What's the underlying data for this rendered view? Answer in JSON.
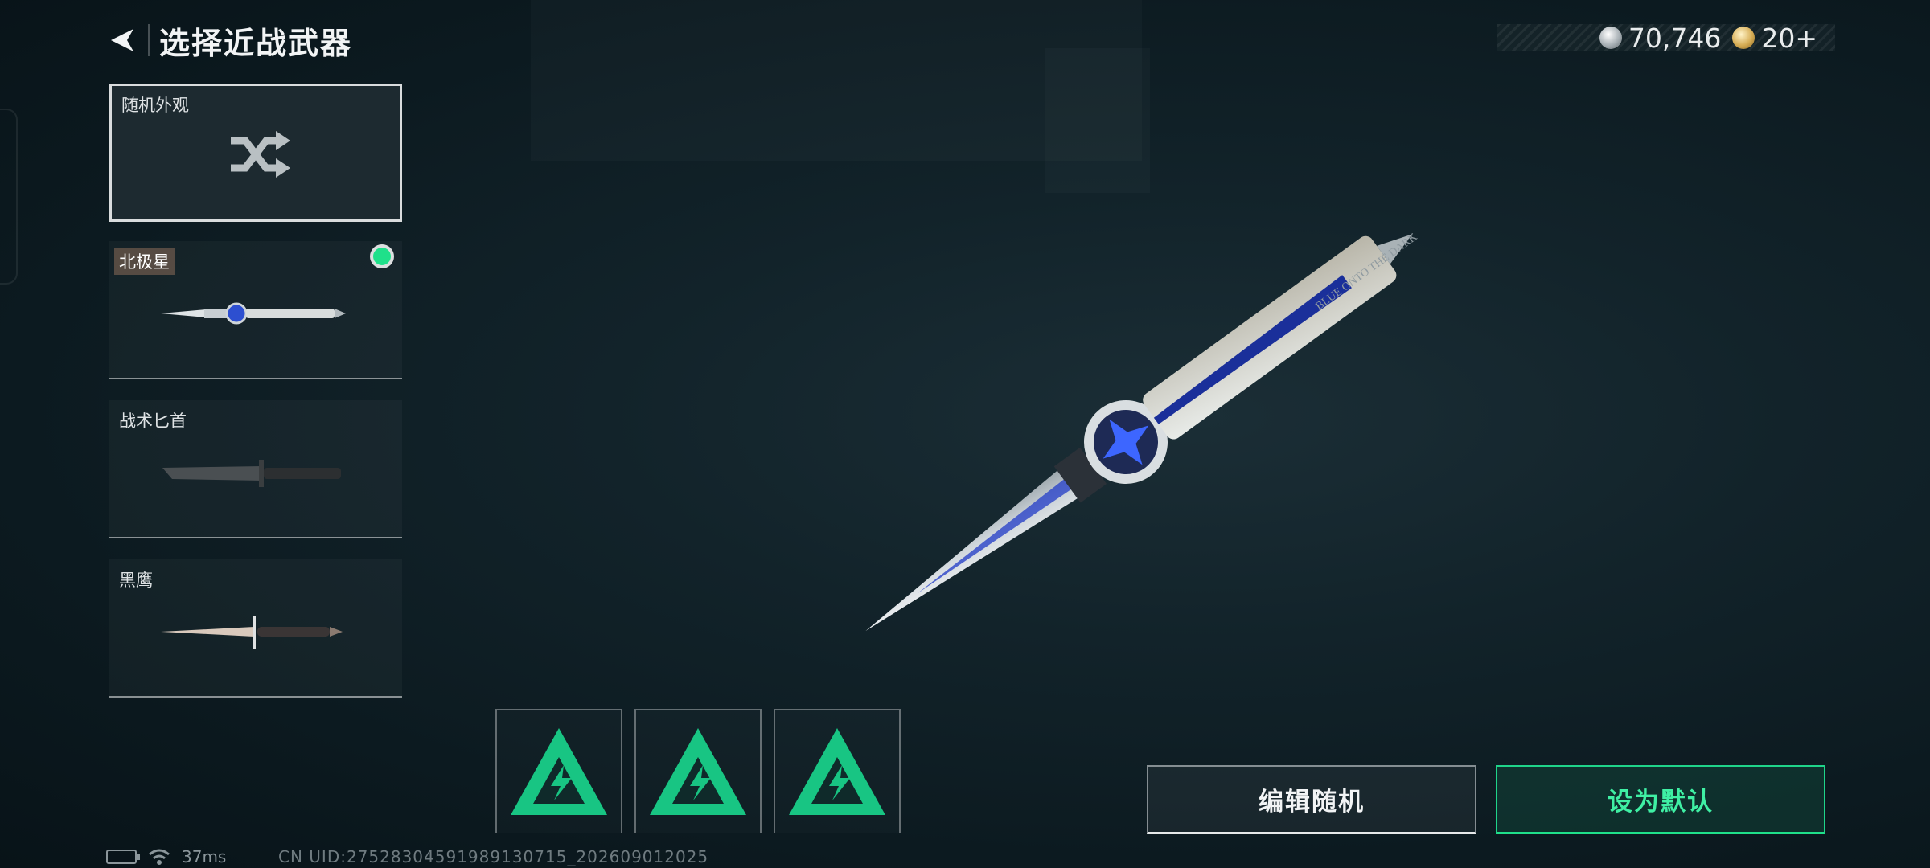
{
  "header": {
    "title": "选择近战武器"
  },
  "currency": {
    "silver": "70,746",
    "gold": "20+"
  },
  "weapons": [
    {
      "name": "随机外观"
    },
    {
      "name": "北极星"
    },
    {
      "name": "战术匕首"
    },
    {
      "name": "黑鹰"
    }
  ],
  "selected_weapon_engraving": "BLUE ONTO THE DARK",
  "actions": {
    "edit_random": "编辑随机",
    "set_default": "设为默认"
  },
  "status": {
    "ping": "37ms",
    "uid": "CN UID:27528304591989130715_202609012025"
  },
  "colors": {
    "accent": "#1fe08a",
    "equipped": "#1fe08a"
  }
}
